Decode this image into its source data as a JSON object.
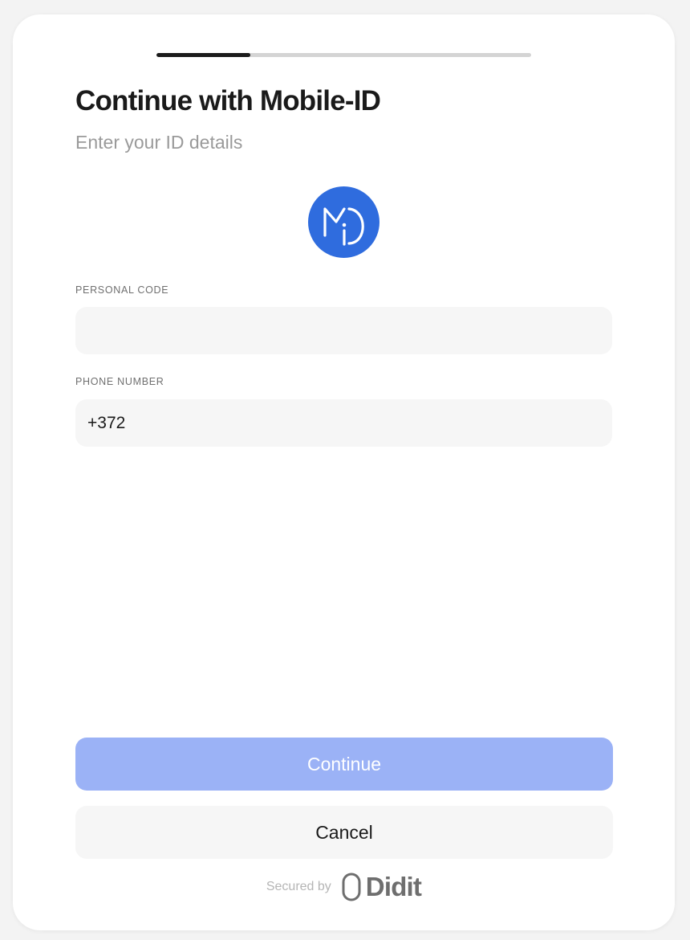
{
  "progress": {
    "value": 0.25
  },
  "header": {
    "title": "Continue with Mobile-ID",
    "subtitle": "Enter your ID details"
  },
  "logo": {
    "icon": "mobile-id-logo",
    "color": "#2f6cde"
  },
  "form": {
    "personal_code": {
      "label": "PERSONAL CODE",
      "value": "",
      "placeholder": ""
    },
    "phone_number": {
      "label": "PHONE NUMBER",
      "value": "+372",
      "placeholder": ""
    }
  },
  "actions": {
    "continue_label": "Continue",
    "cancel_label": "Cancel"
  },
  "footer": {
    "secured_by": "Secured by",
    "brand_name": "Didit"
  },
  "colors": {
    "accent_disabled": "#9bb2f6",
    "progress_fill": "#1b1b1b",
    "progress_track": "#d4d4d4"
  }
}
